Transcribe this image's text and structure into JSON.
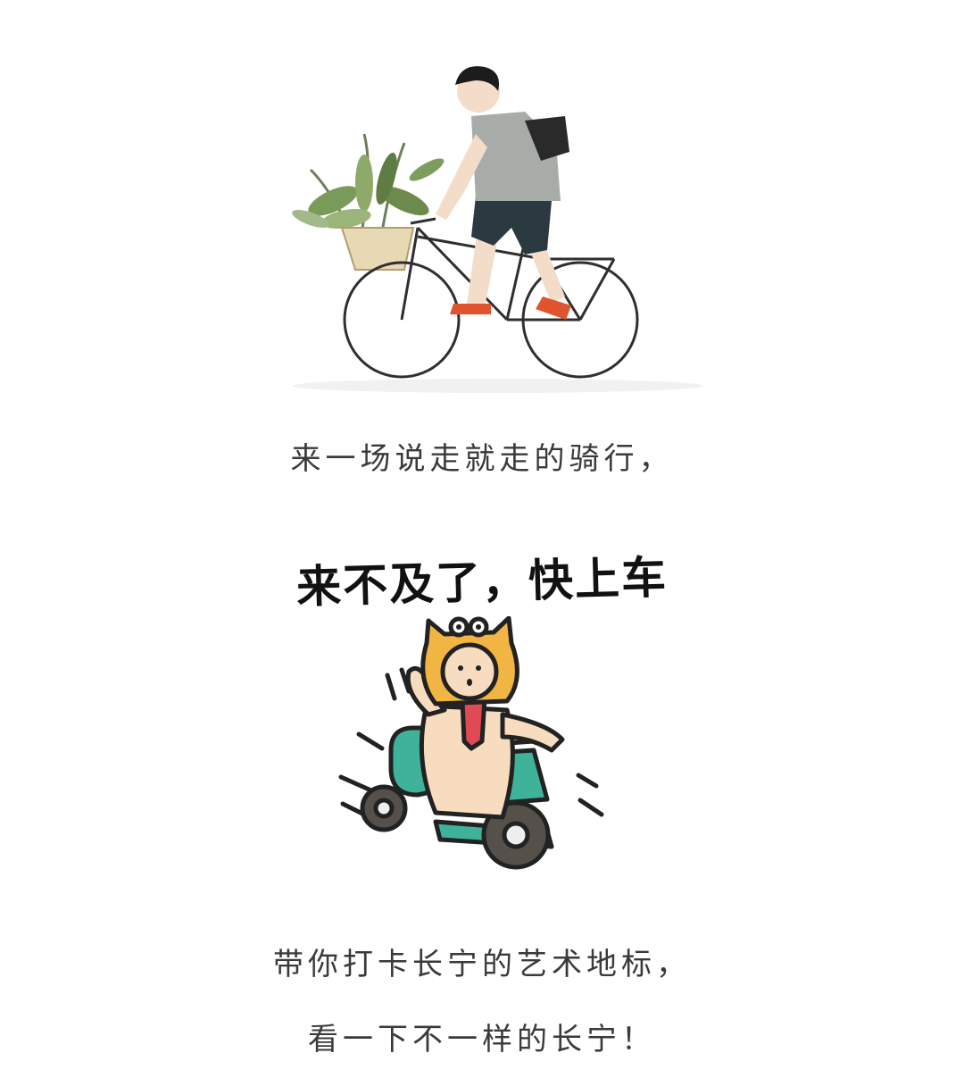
{
  "captions": {
    "line1": "来一场说走就走的骑行，",
    "line2": "带你打卡长宁的艺术地标，",
    "line3": "看一下不一样的长宁！"
  },
  "sticker": {
    "title": "来不及了，快上车"
  },
  "colors": {
    "shirt": "#a7aca9",
    "shorts": "#2a3a40",
    "shoe": "#e0532f",
    "leaf": "#7a9a5a",
    "hood": "#f1b544",
    "skin": "#f8dcbf",
    "tie": "#e04a55",
    "trike": "#3fb39a",
    "tire": "#55504a"
  }
}
